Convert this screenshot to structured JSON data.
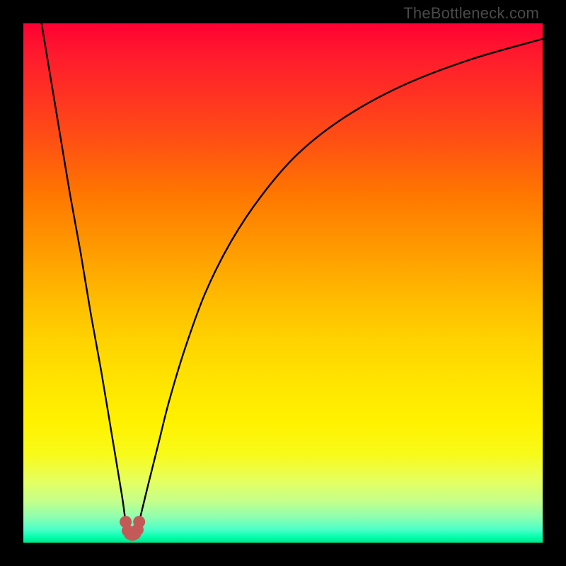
{
  "watermark": "TheBottleneck.com",
  "chart_data": {
    "type": "line",
    "title": "",
    "xlabel": "",
    "ylabel": "",
    "xlim": [
      0,
      100
    ],
    "ylim": [
      0,
      100
    ],
    "grid": false,
    "legend": false,
    "series": [
      {
        "name": "bottleneck-curve",
        "color": "#000000",
        "x": [
          3.5,
          5,
          7,
          9,
          11,
          13,
          15,
          17,
          19,
          19.7,
          20.3,
          21,
          21.7,
          22.3,
          24,
          26,
          28,
          31,
          35,
          40,
          46,
          53,
          62,
          73,
          86,
          100
        ],
        "y": [
          100,
          91,
          79,
          67,
          56,
          44,
          33,
          21,
          9,
          4,
          1.8,
          1.5,
          1.8,
          4,
          11,
          19,
          27,
          37,
          48,
          58,
          67,
          75,
          82,
          88,
          93,
          97
        ]
      },
      {
        "name": "optimal-marker",
        "color": "#c45a57",
        "type": "scatter",
        "x": [
          19.7,
          20.1,
          20.5,
          21.0,
          21.5,
          22.0,
          22.3
        ],
        "y": [
          4.0,
          2.3,
          1.7,
          1.5,
          1.7,
          2.5,
          4.0
        ]
      }
    ],
    "gradient_background": {
      "top_color": "#ff0033",
      "bottom_color": "#00e68a"
    }
  }
}
